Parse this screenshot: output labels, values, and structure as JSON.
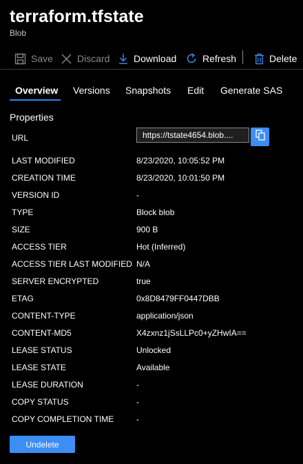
{
  "header": {
    "title": "terraform.tfstate",
    "subtitle": "Blob"
  },
  "toolbar": {
    "save": "Save",
    "discard": "Discard",
    "download": "Download",
    "refresh": "Refresh",
    "delete": "Delete"
  },
  "tabs": [
    "Overview",
    "Versions",
    "Snapshots",
    "Edit",
    "Generate SAS"
  ],
  "properties": {
    "section_title": "Properties",
    "url_label": "URL",
    "url_value": "https://tstate4654.blob....",
    "rows": [
      {
        "label": "LAST MODIFIED",
        "value": "8/23/2020, 10:05:52 PM"
      },
      {
        "label": "CREATION TIME",
        "value": "8/23/2020, 10:01:50 PM"
      },
      {
        "label": "VERSION ID",
        "value": "-"
      },
      {
        "label": "TYPE",
        "value": "Block blob"
      },
      {
        "label": "SIZE",
        "value": "900 B"
      },
      {
        "label": "ACCESS TIER",
        "value": "Hot (Inferred)"
      },
      {
        "label": "ACCESS TIER LAST MODIFIED",
        "value": "N/A"
      },
      {
        "label": "SERVER ENCRYPTED",
        "value": "true"
      },
      {
        "label": "ETAG",
        "value": "0x8D8479FF0447DBB"
      },
      {
        "label": "CONTENT-TYPE",
        "value": "application/json"
      },
      {
        "label": "CONTENT-MD5",
        "value": "X4zxnz1jSsLLPc0+yZHwIA=="
      },
      {
        "label": "LEASE STATUS",
        "value": "Unlocked"
      },
      {
        "label": "LEASE STATE",
        "value": "Available"
      },
      {
        "label": "LEASE DURATION",
        "value": "-"
      },
      {
        "label": "COPY STATUS",
        "value": "-"
      },
      {
        "label": "COPY COMPLETION TIME",
        "value": "-"
      }
    ]
  },
  "actions": {
    "undelete": "Undelete"
  },
  "colors": {
    "accent": "#2b88f0",
    "button": "#3c8ef3",
    "disabled": "#8a8a8a"
  }
}
